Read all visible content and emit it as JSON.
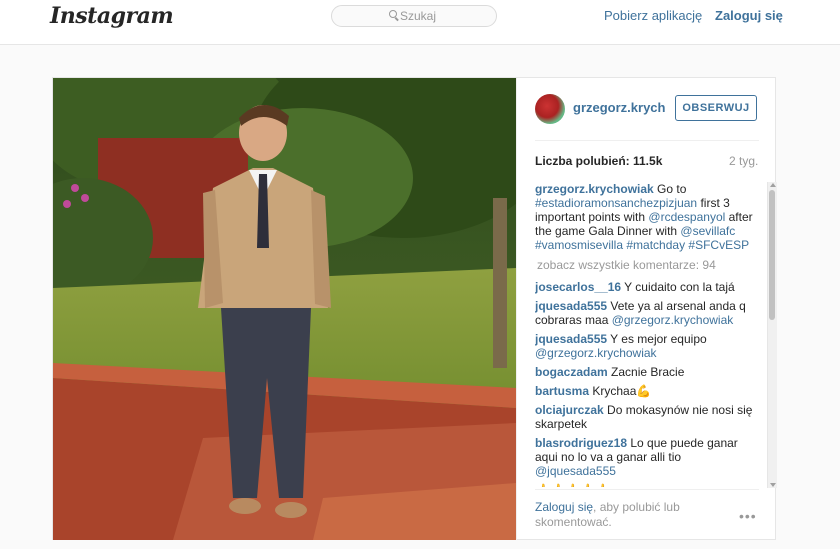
{
  "header": {
    "logo": "Instagram",
    "search_placeholder": "Szukaj",
    "get_app": "Pobierz aplikację",
    "login": "Zaloguj się"
  },
  "post": {
    "username": "grzegorz.krych…",
    "follow_label": "OBSERWUJ",
    "likes": "Liczba polubień: 11.5k",
    "age": "2 tyg.",
    "caption_author": "grzegorz.krychowiak",
    "caption_parts": [
      {
        "text": " Go to ",
        "tag": false
      },
      {
        "text": "#estadioramonsanchezpizjuan",
        "tag": true
      },
      {
        "text": " first 3 important points with ",
        "tag": false
      },
      {
        "text": "@rcdespanyol",
        "tag": true
      },
      {
        "text": " after the game Gala Dinner with ",
        "tag": false
      },
      {
        "text": "@sevillafc",
        "tag": true
      },
      {
        "text": " ",
        "tag": false
      },
      {
        "text": "#vamosmisevilla",
        "tag": true
      },
      {
        "text": " ",
        "tag": false
      },
      {
        "text": "#matchday",
        "tag": true
      },
      {
        "text": " ",
        "tag": false
      },
      {
        "text": "#SFCvESP",
        "tag": true
      }
    ],
    "view_all": "zobacz wszystkie komentarze: 94",
    "comments": [
      {
        "author": "josecarlos__16",
        "parts": [
          {
            "text": " Y cuidaito con la tajá",
            "tag": false
          }
        ]
      },
      {
        "author": "jquesada555",
        "parts": [
          {
            "text": " Vete ya al arsenal anda q cobraras maa ",
            "tag": false
          },
          {
            "text": "@grzegorz.krychowiak",
            "tag": true
          }
        ]
      },
      {
        "author": "jquesada555",
        "parts": [
          {
            "text": " Y es mejor equipo ",
            "tag": false
          },
          {
            "text": "@grzegorz.krychowiak",
            "tag": true
          }
        ]
      },
      {
        "author": "bogaczadam",
        "parts": [
          {
            "text": " Zacnie Bracie",
            "tag": false
          }
        ]
      },
      {
        "author": "bartusma",
        "parts": [
          {
            "text": " Krychaa💪",
            "tag": false
          }
        ]
      },
      {
        "author": "olciajurczak",
        "parts": [
          {
            "text": " Do mokasynów nie nosi się skarpetek",
            "tag": false
          }
        ]
      },
      {
        "author": "blasrodriguez18",
        "parts": [
          {
            "text": " Lo que puede ganar aqui no lo va a ganar alli tio ",
            "tag": false
          },
          {
            "text": "@jquesada555",
            "tag": true
          }
        ]
      },
      {
        "author": "",
        "parts": [
          {
            "text": "👍👍👍👍👍",
            "tag": false
          }
        ]
      }
    ],
    "cta_link": "Zaloguj się",
    "cta_text": ", aby polubić lub skomentować.",
    "more": "•••"
  }
}
